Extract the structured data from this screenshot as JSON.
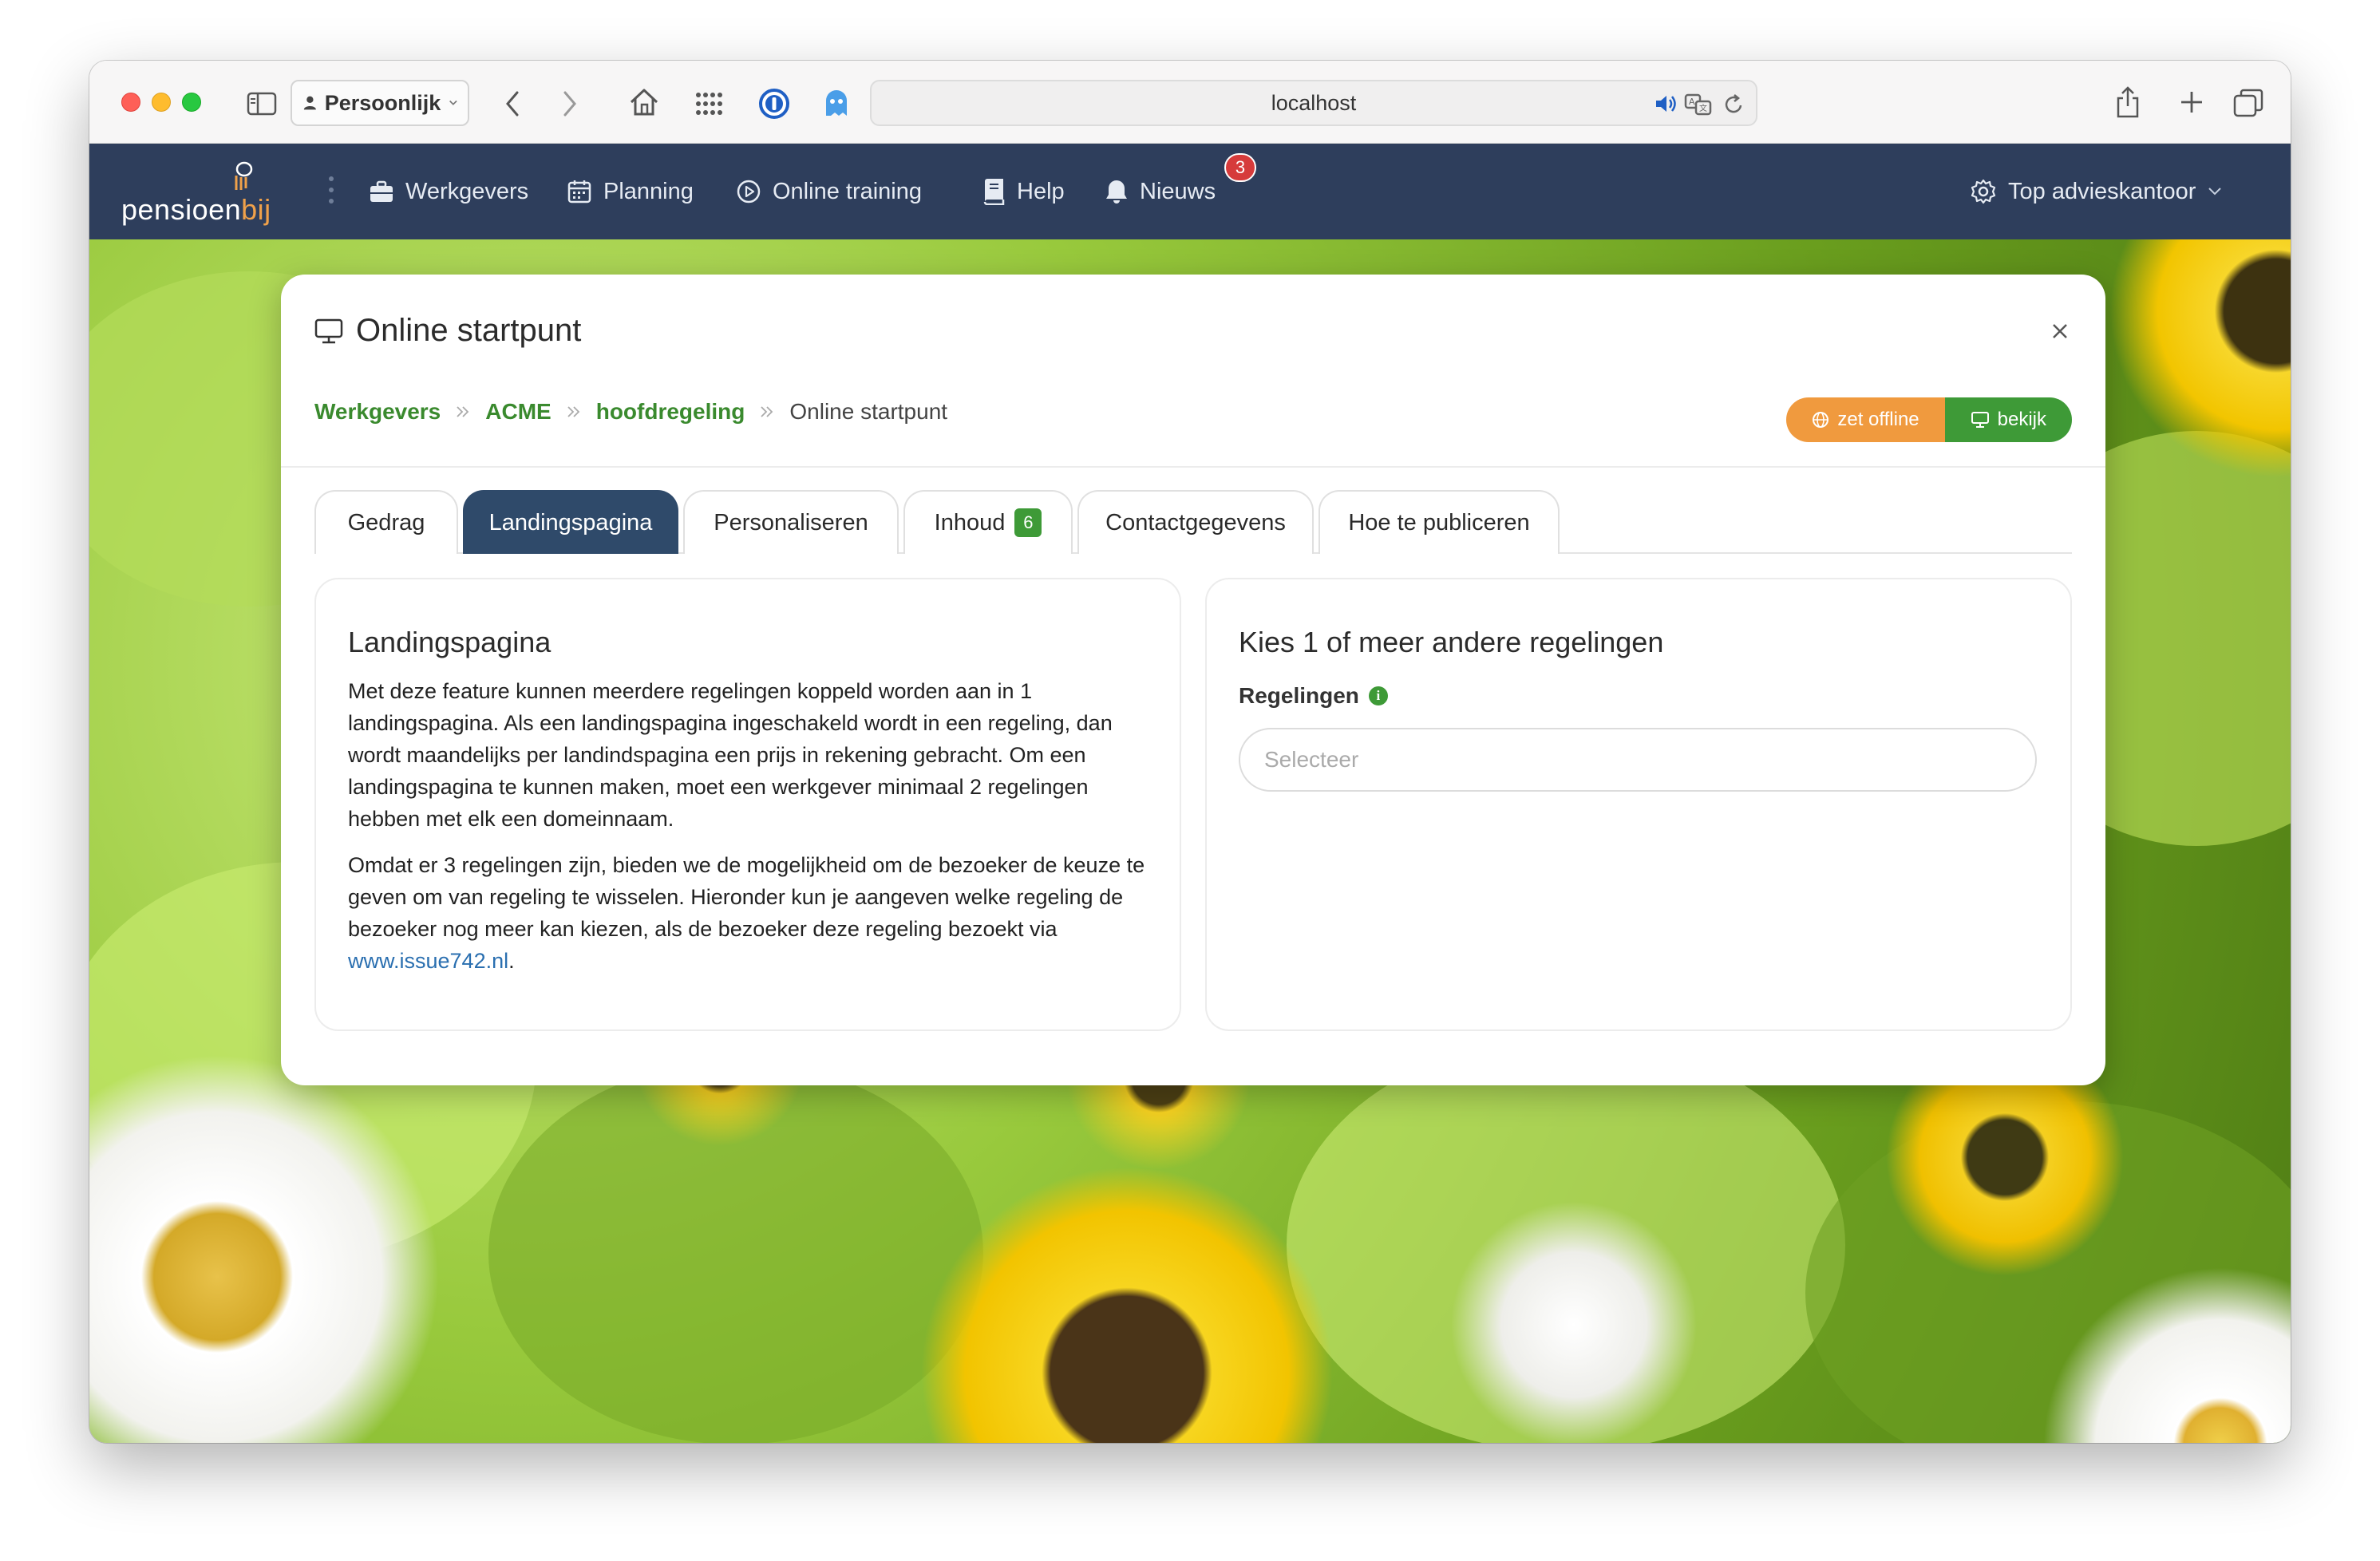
{
  "browser": {
    "profile_label": "Persoonlijk",
    "url": "localhost"
  },
  "nav": {
    "logo": {
      "text_main": "pensioen",
      "text_accent": "bij"
    },
    "items": [
      {
        "label": "Werkgevers",
        "icon": "briefcase-icon"
      },
      {
        "label": "Planning",
        "icon": "calendar-icon"
      },
      {
        "label": "Online training",
        "icon": "play-circle-icon"
      },
      {
        "label": "Help",
        "icon": "book-icon"
      },
      {
        "label": "Nieuws",
        "icon": "bell-icon",
        "badge": "3"
      }
    ],
    "account_label": "Top advieskantoor"
  },
  "modal": {
    "title": "Online startpunt",
    "breadcrumb": [
      "Werkgevers",
      "ACME",
      "hoofdregeling",
      "Online startpunt"
    ],
    "buttons": {
      "offline": "zet offline",
      "view": "bekijk"
    },
    "tabs": [
      {
        "label": "Gedrag"
      },
      {
        "label": "Landingspagina",
        "active": true
      },
      {
        "label": "Personaliseren"
      },
      {
        "label": "Inhoud",
        "count": "6"
      },
      {
        "label": "Contactgegevens"
      },
      {
        "label": "Hoe te publiceren"
      }
    ],
    "left_panel": {
      "heading": "Landingspagina",
      "paragraph1": "Met deze feature kunnen meerdere regelingen koppeld worden aan in 1 landingspagina. Als een landingspagina ingeschakeld wordt in een regeling, dan wordt maandelijks per landindspagina een prijs in rekening gebracht. Om een landingspagina te kunnen maken, moet een werkgever minimaal 2 regelingen hebben met elk een domeinnaam.",
      "paragraph2": "Omdat er 3 regelingen zijn, bieden we de mogelijkheid om de bezoeker de keuze te geven om van regeling te wisselen. Hieronder kun je aangeven welke regeling de bezoeker nog meer kan kiezen, als de bezoeker deze regeling bezoekt via",
      "link": "www.issue742.nl",
      "after_link": "."
    },
    "right_panel": {
      "heading": "Kies 1 of meer andere regelingen",
      "field_label": "Regelingen",
      "select_placeholder": "Selecteer"
    }
  },
  "colors": {
    "nav_bg": "#2e3e5c",
    "accent_green": "#3e9a37",
    "accent_orange": "#f09a3e",
    "active_tab": "#2f4a6a",
    "badge_red": "#d63b3b"
  }
}
